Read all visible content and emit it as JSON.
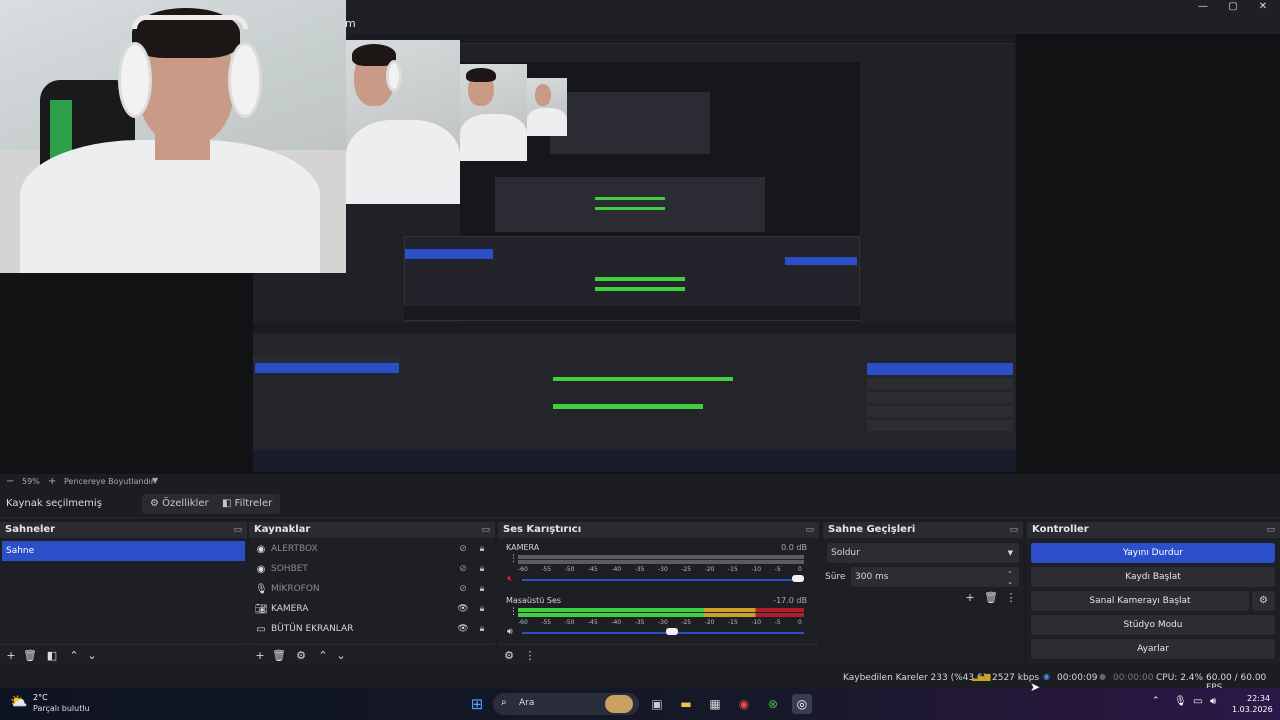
{
  "window": {
    "title_fragment": "m"
  },
  "preview": {
    "zoom": "59%",
    "fit_label": "Pencereye Boyutlandır",
    "zoom_minus": "−",
    "zoom_plus": "+"
  },
  "source_toolbar": {
    "status": "Kaynak seçilmemiş",
    "properties": "Özellikler",
    "filters": "Filtreler"
  },
  "scenes": {
    "title": "Sahneler",
    "items": [
      {
        "label": "Sahne",
        "selected": true
      }
    ]
  },
  "sources": {
    "title": "Kaynaklar",
    "items": [
      {
        "label": "ALERTBOX",
        "icon": "browser-icon",
        "visible": false
      },
      {
        "label": "SOHBET",
        "icon": "browser-icon",
        "visible": false
      },
      {
        "label": "MİKROFON",
        "icon": "microphone-icon",
        "visible": false
      },
      {
        "label": "KAMERA",
        "icon": "camera-icon",
        "visible": true
      },
      {
        "label": "BÜTÜN EKRANLAR",
        "icon": "monitor-icon",
        "visible": true
      }
    ]
  },
  "mixer": {
    "title": "Ses Karıştırıcı",
    "channels": [
      {
        "name": "KAMERA",
        "db": "0.0 dB",
        "level": 0,
        "muted": true,
        "fader": 0.97
      },
      {
        "name": "Masaüstü Ses",
        "db": "-17.0 dB",
        "level": 0.65,
        "muted": false,
        "fader": 0.52
      }
    ],
    "scale": [
      "-60",
      "-55",
      "-50",
      "-45",
      "-40",
      "-35",
      "-30",
      "-25",
      "-20",
      "-15",
      "-10",
      "-5",
      "0"
    ]
  },
  "transitions": {
    "title": "Sahne Geçişleri",
    "selected": "Soldur",
    "duration_label": "Süre",
    "duration_value": "300 ms"
  },
  "controls": {
    "title": "Kontroller",
    "stop_stream": "Yayını Durdur",
    "start_record": "Kaydı Başlat",
    "start_virtualcam": "Sanal Kamerayı Başlat",
    "studio_mode": "Stüdyo Modu",
    "settings": "Ayarlar"
  },
  "status": {
    "dropped_frames": "Kaybedilen Kareler 233 (%43.6)",
    "bitrate": "2527 kbps",
    "stream_time": "00:00:09",
    "record_time": "00:00:00",
    "cpu": "CPU: 2.4%",
    "fps": "60.00 / 60.00 FPS"
  },
  "taskbar": {
    "weather_temp": "2°C",
    "weather_desc": "Parçalı bulutlu",
    "search": "Ara",
    "time": "22:34",
    "date": "1.03.2026"
  },
  "colors": {
    "accent": "#2b4fc9",
    "meter_green": "#3fcf3f",
    "meter_yellow": "#c9a227",
    "meter_red": "#b01e2b"
  }
}
